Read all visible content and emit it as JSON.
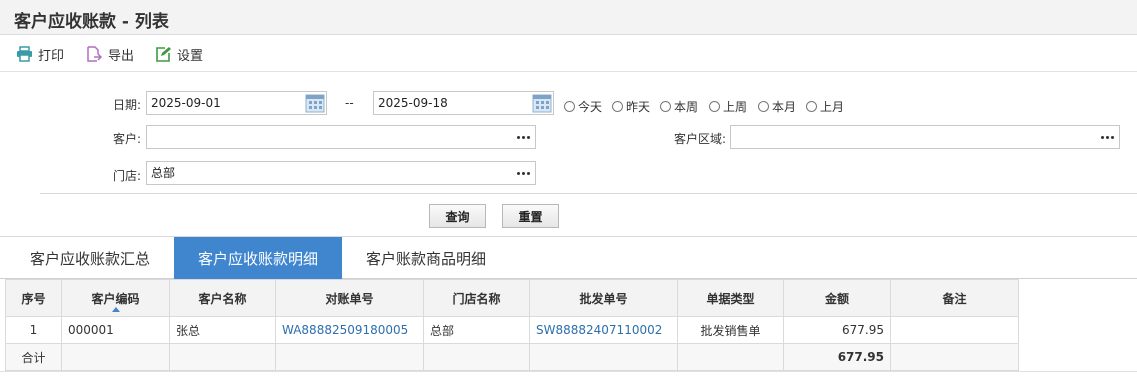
{
  "page": {
    "title": "客户应收账款 - 列表"
  },
  "toolbar": {
    "print_label": "打印",
    "export_label": "导出",
    "settings_label": "设置"
  },
  "filters": {
    "date_label": "日期:",
    "date_from": "2025-09-01",
    "date_sep": "--",
    "date_to": "2025-09-18",
    "quick_ranges": [
      "今天",
      "昨天",
      "本周",
      "上周",
      "本月",
      "上月"
    ],
    "customer_label": "客户:",
    "customer_value": "",
    "region_label": "客户区域:",
    "region_value": "",
    "store_label": "门店:",
    "store_value": "总部"
  },
  "actions": {
    "query_label": "查询",
    "reset_label": "重置"
  },
  "tabs": [
    {
      "label": "客户应收账款汇总",
      "active": false
    },
    {
      "label": "客户应收账款明细",
      "active": true
    },
    {
      "label": "客户账款商品明细",
      "active": false
    }
  ],
  "table": {
    "headers": [
      "序号",
      "客户编码",
      "客户名称",
      "对账单号",
      "门店名称",
      "批发单号",
      "单据类型",
      "金额",
      "备注"
    ],
    "rows": [
      {
        "index": "1",
        "code": "000001",
        "name": "张总",
        "statement_no": "WA88882509180005",
        "store": "总部",
        "wholesale_no": "SW88882407110002",
        "doc_type": "批发销售单",
        "amount": "677.95",
        "remark": ""
      }
    ],
    "total": {
      "label": "合计",
      "amount": "677.95"
    }
  },
  "colors": {
    "accent": "#3f86cf",
    "link": "#2c6fb0",
    "print_icon": "#3a9aa8",
    "export_icon": "#b06fc0",
    "settings_icon": "#3f9a3f"
  }
}
